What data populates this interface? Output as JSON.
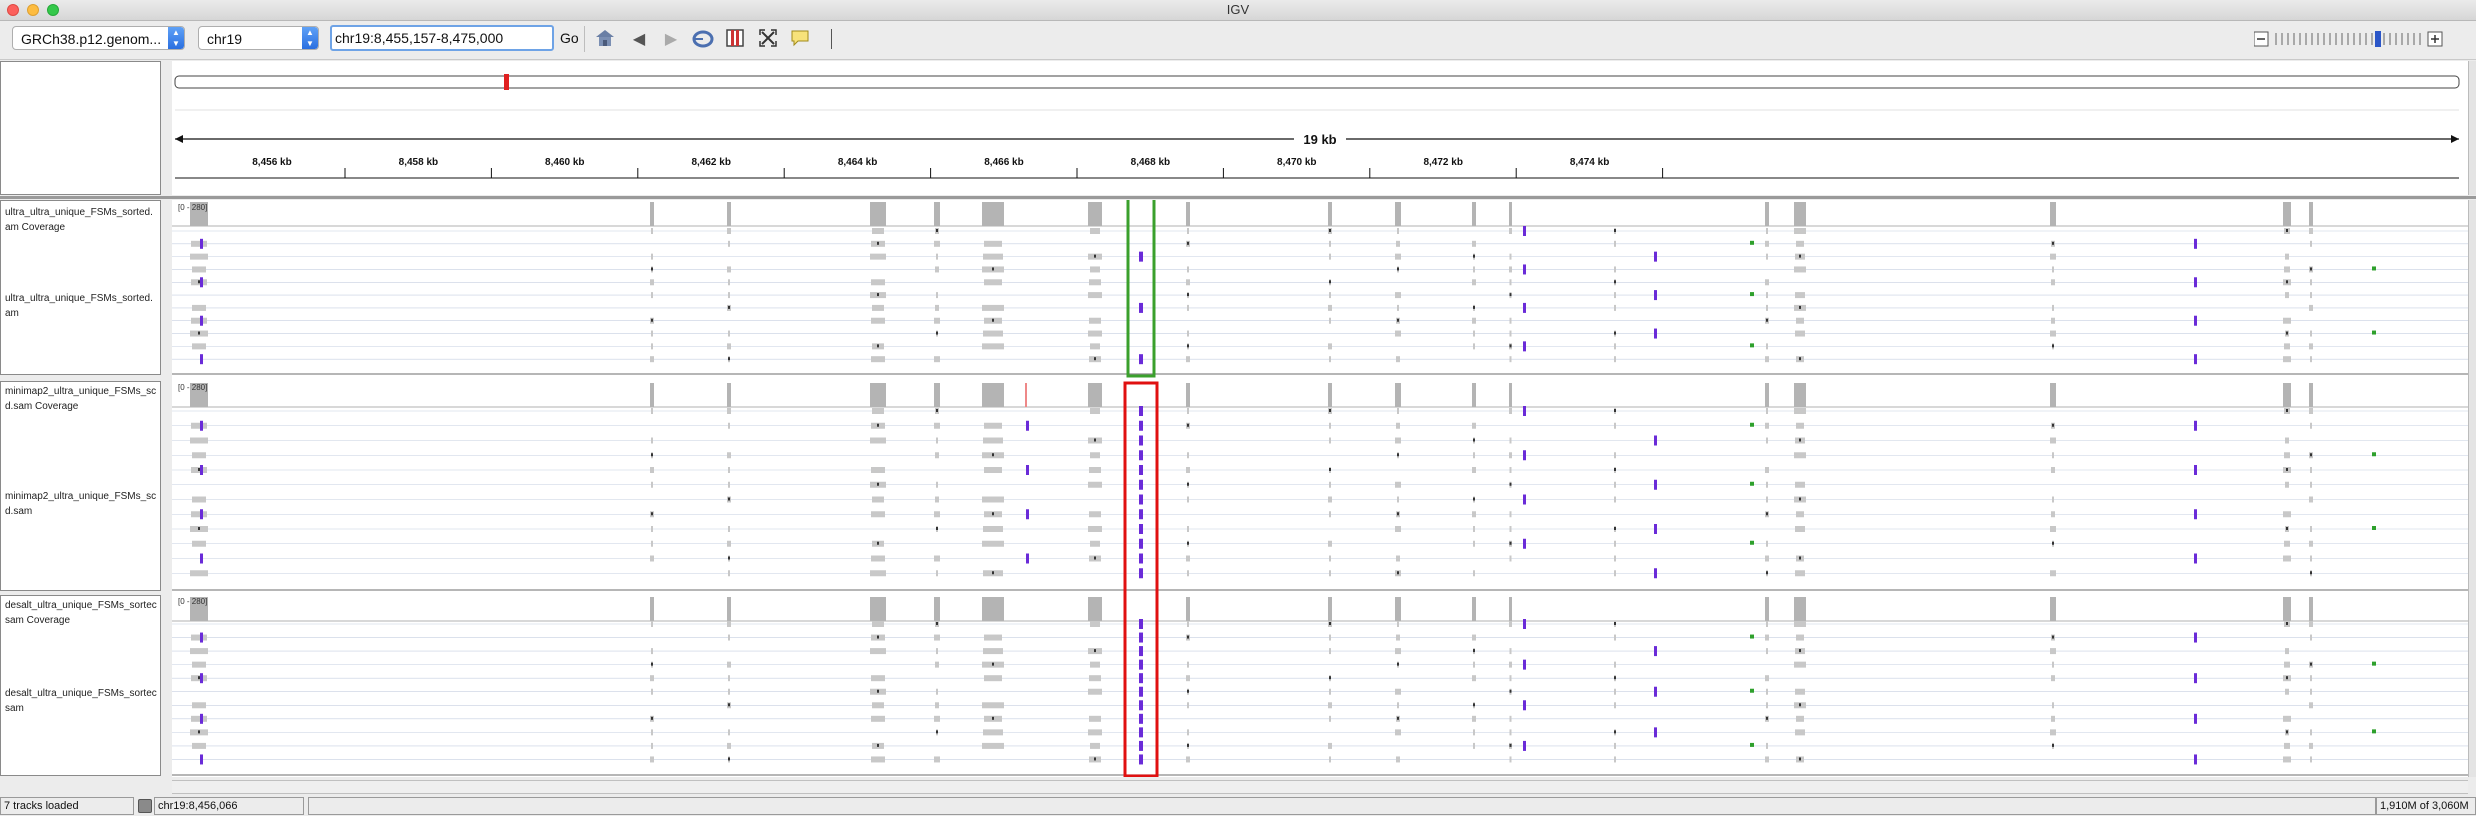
{
  "window": {
    "title": "IGV"
  },
  "toolbar": {
    "genome": "GRCh38.p12.genom...",
    "chromosome": "chr19",
    "locus": "chr19:8,455,157-8,475,000",
    "go_label": "Go"
  },
  "ruler": {
    "span_label": "19 kb",
    "ticks": [
      "8,456 kb",
      "8,458 kb",
      "8,460 kb",
      "8,462 kb",
      "8,464 kb",
      "8,466 kb",
      "8,468 kb",
      "8,470 kb",
      "8,472 kb",
      "8,474 kb"
    ]
  },
  "tracks": [
    {
      "coverage_name": "ultra_ultra_unique_FSMs_sorted.\nam Coverage",
      "alignment_name": "ultra_ultra_unique_FSMs_sorted.\nam",
      "range": "[0 - 280]"
    },
    {
      "coverage_name": "minimap2_ultra_unique_FSMs_sc\nd.sam Coverage",
      "alignment_name": "minimap2_ultra_unique_FSMs_sc\nd.sam",
      "range": "[0 - 280]"
    },
    {
      "coverage_name": "desalt_ultra_unique_FSMs_sortec\nsam Coverage",
      "alignment_name": "desalt_ultra_unique_FSMs_sortec\nsam",
      "range": "[0 - 280]"
    }
  ],
  "status": {
    "tracks_loaded": "7 tracks loaded",
    "position": "chr19:8,456,066",
    "memory": "1,910M of 3,060M"
  },
  "colors": {
    "highlight_green": "#3aa02c",
    "highlight_red": "#e01010",
    "insertion": "#6a2bd8",
    "coverage": "#b4b4b4",
    "read": "#c8c8c8"
  },
  "icons": [
    "home-icon",
    "back-icon",
    "forward-icon",
    "refresh-icon",
    "region-icon",
    "fit-icon",
    "popup-icon",
    "zoom-out-icon",
    "zoom-in-icon"
  ]
}
